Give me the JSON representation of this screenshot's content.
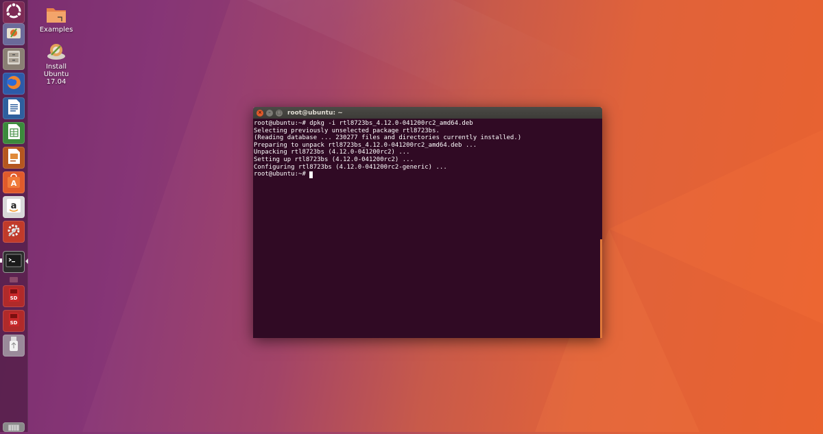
{
  "desktop": {
    "icons": [
      {
        "label": "Examples"
      },
      {
        "label": "Install\nUbuntu\n17.04"
      }
    ]
  },
  "launcher": {
    "items": [
      {
        "name": "ubuntu-dash"
      },
      {
        "name": "software-updater"
      },
      {
        "name": "files"
      },
      {
        "name": "firefox"
      },
      {
        "name": "libreoffice-writer"
      },
      {
        "name": "libreoffice-calc"
      },
      {
        "name": "libreoffice-impress"
      },
      {
        "name": "ubuntu-software"
      },
      {
        "name": "amazon"
      },
      {
        "name": "system-settings"
      },
      {
        "name": "terminal"
      },
      {
        "name": "sd-card-1"
      },
      {
        "name": "sd-card-2"
      },
      {
        "name": "usb-drive"
      },
      {
        "name": "trash"
      }
    ]
  },
  "terminal": {
    "title": "root@ubuntu: ~",
    "lines": [
      "root@ubuntu:~# dpkg -i rtl8723bs_4.12.0-041200rc2_amd64.deb",
      "Selecting previously unselected package rtl8723bs.",
      "(Reading database ... 230277 files and directories currently installed.)",
      "Preparing to unpack rtl8723bs_4.12.0-041200rc2_amd64.deb ...",
      "Unpacking rtl8723bs (4.12.0-041200rc2) ...",
      "Setting up rtl8723bs (4.12.0-041200rc2) ...",
      "Configuring rtl8723bs (4.12.0-041200rc2-generic) ..."
    ],
    "prompt": "root@ubuntu:~# "
  },
  "colors": {
    "terminal_bg": "#300a24",
    "accent": "#e05a2b"
  }
}
